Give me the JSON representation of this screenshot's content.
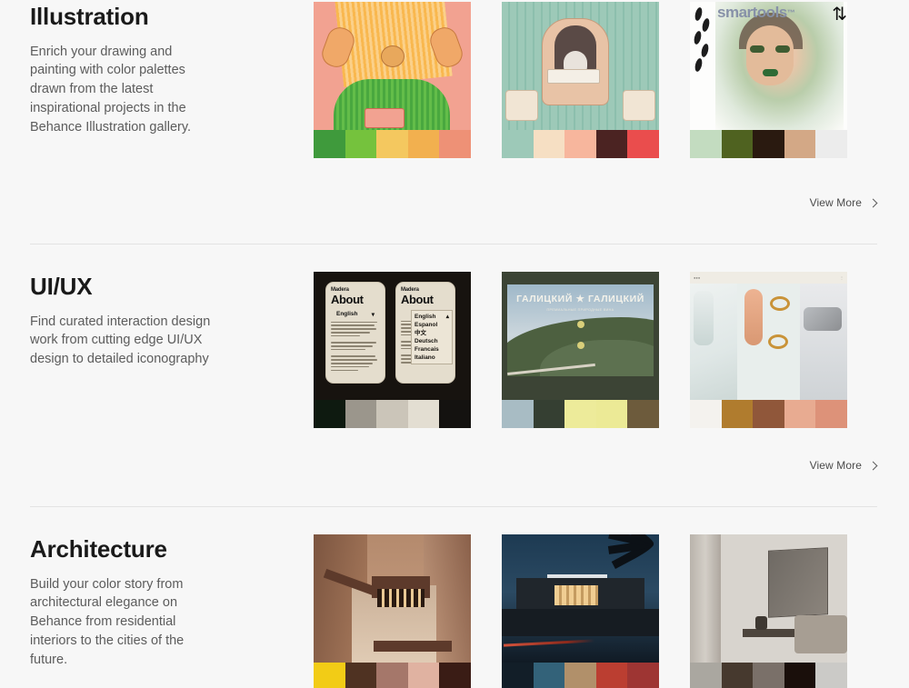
{
  "theme": {
    "page_background": "#f7f7f7",
    "card_background": "#ffffff",
    "divider": "#e3e3e3",
    "title_color": "#1a1a1a",
    "body_color": "#5c5c5c",
    "link_color": "#4a4a4a"
  },
  "sections": [
    {
      "id": "illustration",
      "title": "Illustration",
      "description": "Enrich your drawing and painting with color palettes drawn from the latest inspirational projects in the Behance Illustration gallery.",
      "view_more_label": "View More",
      "view_more_icon": "chevron-right-icon",
      "cards": [
        {
          "name": "illustration-card-1",
          "artwork": "figure-with-laptop-illustration",
          "palette": [
            "#3f9a3c",
            "#75c23d",
            "#f4c85f",
            "#f2b04f",
            "#ee9176"
          ]
        },
        {
          "name": "illustration-card-2",
          "artwork": "raccoon-reading-in-armchair-illustration",
          "palette": [
            "#9dc9b8",
            "#f6dfc3",
            "#f7b69d",
            "#4b2322",
            "#ea4d4d"
          ]
        },
        {
          "name": "illustration-card-3",
          "artwork": "watercolor-portrait-illustration",
          "overlay_text": "smartools",
          "overlay_trademark": "™",
          "overlay_icon": "up-down-arrows-icon",
          "palette": [
            "#c3dcc0",
            "#4f6220",
            "#2a1a10",
            "#d3a886",
            "#ececec"
          ]
        }
      ]
    },
    {
      "id": "uiux",
      "title": "UI/UX",
      "description": "Find curated interaction design work from cutting edge UI/UX design to detailed iconography",
      "view_more_label": "View More",
      "view_more_icon": "chevron-right-icon",
      "cards": [
        {
          "name": "uiux-card-1",
          "artwork": "mobile-app-about-screens-mockup",
          "phone_brand": "Madera",
          "phone_heading": "About",
          "language_selected": "English",
          "language_options": [
            "English",
            "Espanol",
            "中文",
            "Deutsch",
            "Francais",
            "Italiano"
          ],
          "palette": [
            "#0e1a10",
            "#9b968c",
            "#cbc5b9",
            "#e3ded2",
            "#141210"
          ]
        },
        {
          "name": "uiux-card-2",
          "artwork": "landscape-website-hero-mockup",
          "site_title": "ГАЛИЦКИЙ ★ ГАЛИЦКИЙ",
          "site_subtitle": "ПРЕМИАЛЬНЫЕ ПРИРОДНЫЕ ВИНА",
          "palette": [
            "#a8bcc4",
            "#353f32",
            "#edeb9a",
            "#ecea96",
            "#6d5b3c"
          ]
        },
        {
          "name": "uiux-card-3",
          "artwork": "jewelry-rings-editorial-mockup",
          "palette": [
            "#f4f2ee",
            "#b07c2e",
            "#90573a",
            "#e8ab91",
            "#dd9279"
          ]
        }
      ]
    },
    {
      "id": "architecture",
      "title": "Architecture",
      "description": "Build your color story from architectural elegance on Behance from residential interiors to the cities of the future.",
      "cards": [
        {
          "name": "architecture-card-1",
          "artwork": "canyon-stairway-architecture-photo",
          "palette": [
            "#f2cc16",
            "#4f3222",
            "#a5776a",
            "#e0b2a1",
            "#3a1c15"
          ]
        },
        {
          "name": "architecture-card-2",
          "artwork": "modern-house-at-dusk-photo",
          "palette": [
            "#121e28",
            "#336279",
            "#b1906a",
            "#bb3e31",
            "#9e3533"
          ]
        },
        {
          "name": "architecture-card-3",
          "artwork": "minimal-gray-interior-photo",
          "palette": [
            "#aaa7a0",
            "#46392e",
            "#7a7069",
            "#1a0f0b",
            "#cbcac7"
          ]
        }
      ]
    }
  ]
}
